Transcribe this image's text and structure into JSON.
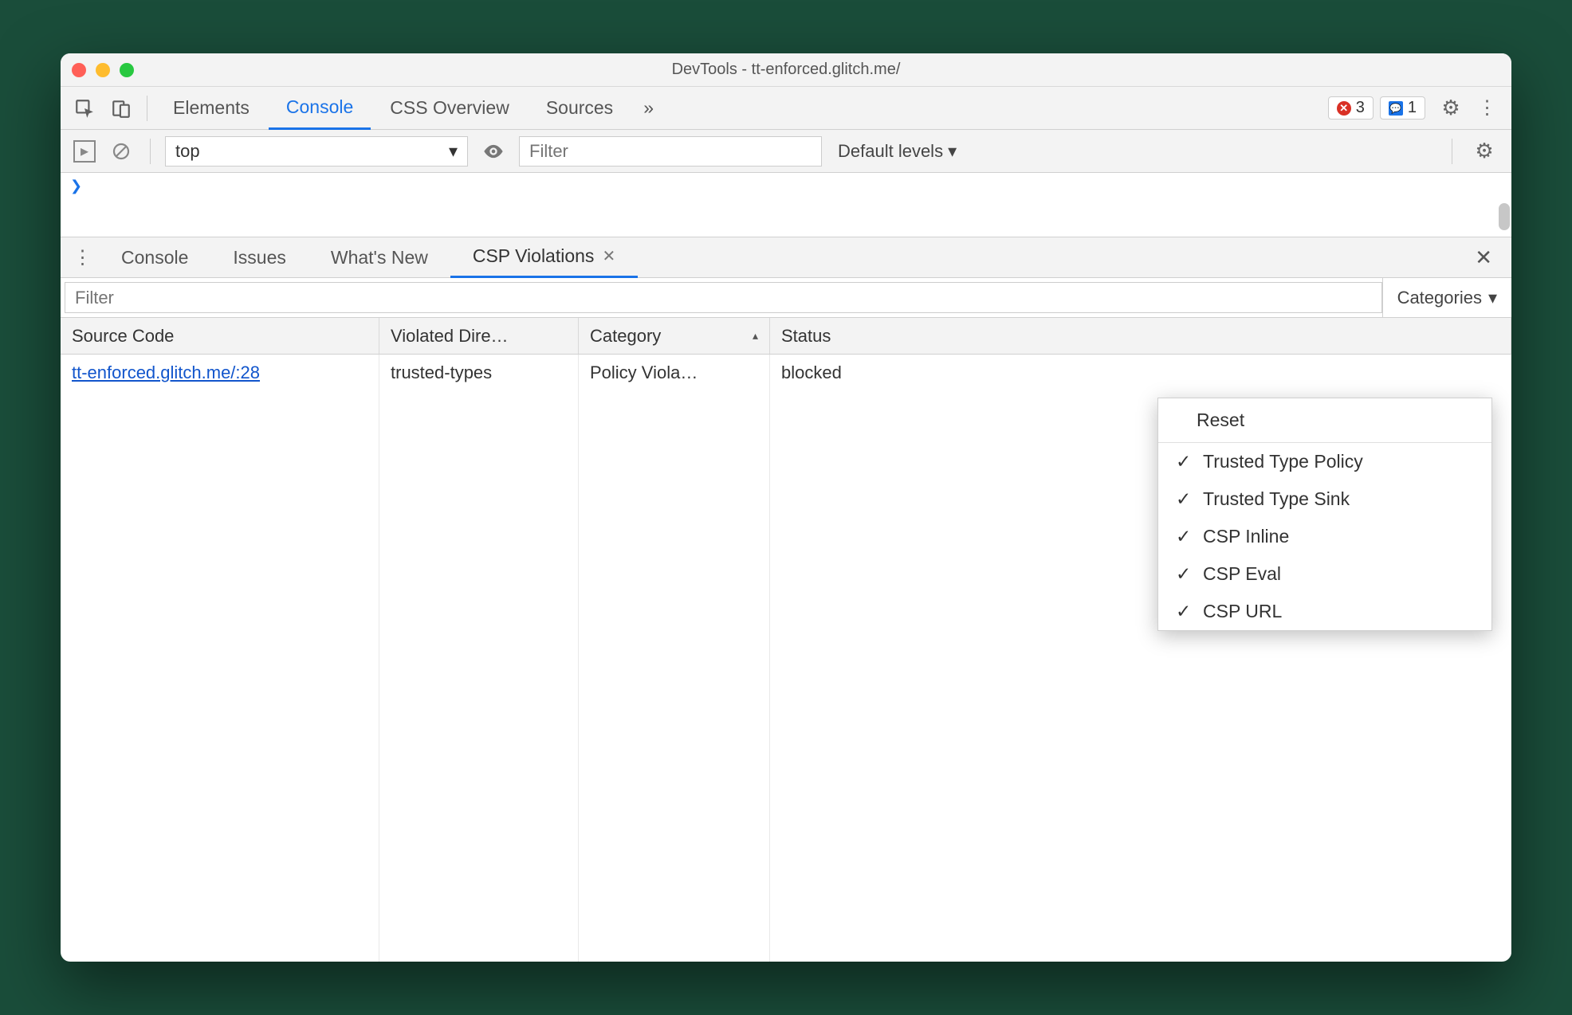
{
  "window": {
    "title": "DevTools - tt-enforced.glitch.me/"
  },
  "mainTabs": {
    "items": [
      "Elements",
      "Console",
      "CSS Overview",
      "Sources"
    ],
    "active": "Console",
    "more": "»"
  },
  "badges": {
    "errors": "3",
    "messages": "1"
  },
  "consoleBar": {
    "context": "top",
    "filterPlaceholder": "Filter",
    "levels": "Default levels"
  },
  "drawer": {
    "tabs": [
      "Console",
      "Issues",
      "What's New",
      "CSP Violations"
    ],
    "active": "CSP Violations"
  },
  "cspPanel": {
    "filterPlaceholder": "Filter",
    "categoriesLabel": "Categories"
  },
  "table": {
    "headers": {
      "source": "Source Code",
      "directive": "Violated Dire…",
      "category": "Category",
      "status": "Status"
    },
    "rows": [
      {
        "source": "tt-enforced.glitch.me/:28",
        "directive": "trusted-types",
        "category": "Policy Viola…",
        "status": "blocked"
      }
    ]
  },
  "dropdown": {
    "reset": "Reset",
    "options": [
      "Trusted Type Policy",
      "Trusted Type Sink",
      "CSP Inline",
      "CSP Eval",
      "CSP URL"
    ]
  }
}
